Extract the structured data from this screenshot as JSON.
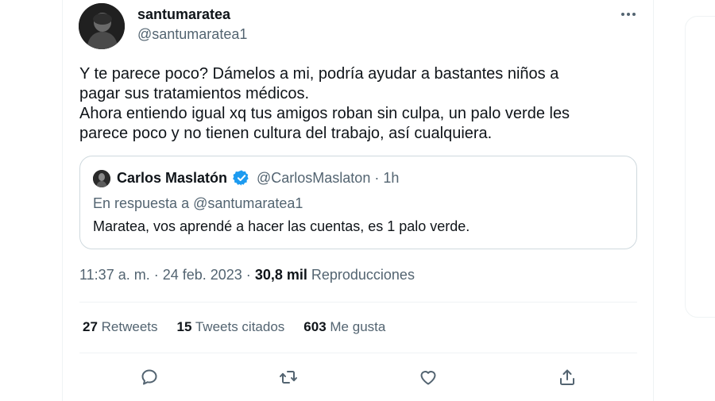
{
  "tweet": {
    "author": {
      "display_name": "santumaratea",
      "handle": "@santumaratea1"
    },
    "text": "Y te parece poco? Dámelos a mi, podría ayudar a bastantes niños a\npagar sus tratamientos médicos.\nAhora entiendo igual xq tus amigos roban sin culpa, un palo verde les\nparece poco y no tienen cultura del trabajo, así cualquiera.",
    "quote": {
      "display_name": "Carlos Maslatón",
      "handle_time": "@CarlosMaslaton · 1h",
      "reply_context": "En respuesta a @santumaratea1",
      "text": "Maratea, vos aprendé a hacer las cuentas, es 1 palo verde.",
      "verified": true
    },
    "timestamp": "11:37 a. m. · 24 feb. 2023 · ",
    "views_count": "30,8 mil",
    "views_label": " Reproducciones",
    "stats": {
      "retweets_count": "27",
      "retweets_label": " Retweets",
      "quotes_count": "15",
      "quotes_label": " Tweets citados",
      "likes_count": "603",
      "likes_label": " Me gusta"
    }
  },
  "icons": {
    "more": "more-horizontal-icon",
    "reply": "reply-icon",
    "retweet": "retweet-icon",
    "like": "heart-icon",
    "share": "share-icon",
    "verified": "verified-badge-icon"
  },
  "colors": {
    "text_primary": "#0f1419",
    "text_secondary": "#536471",
    "verified": "#1d9bf0",
    "border": "#cfd9de"
  }
}
